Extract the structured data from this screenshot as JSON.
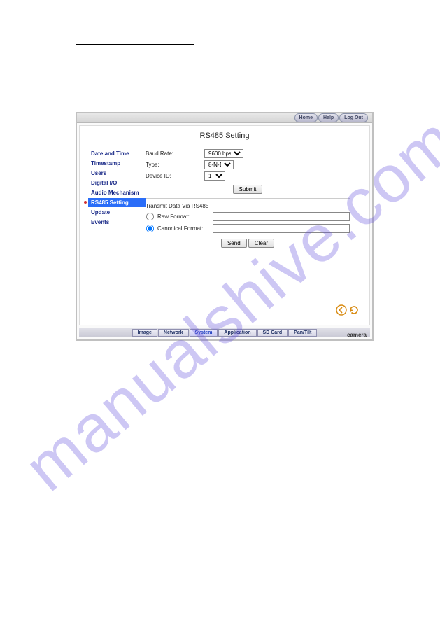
{
  "watermark": "manualshive.com",
  "topButtons": {
    "home": "Home",
    "help": "Help",
    "logout": "Log Out"
  },
  "title": "RS485 Setting",
  "sidebar": {
    "items": [
      {
        "label": "Date and Time"
      },
      {
        "label": "Timestamp"
      },
      {
        "label": "Users"
      },
      {
        "label": "Digital I/O"
      },
      {
        "label": "Audio Mechanism"
      },
      {
        "label": "RS485 Setting"
      },
      {
        "label": "Update"
      },
      {
        "label": "Events"
      }
    ],
    "activeIndex": 5
  },
  "settings": {
    "baudRate": {
      "label": "Baud Rate:",
      "value": "9600 bps"
    },
    "type": {
      "label": "Type:",
      "value": "8-N-1"
    },
    "deviceId": {
      "label": "Device ID:",
      "value": "1"
    },
    "submitLabel": "Submit"
  },
  "transmit": {
    "heading": "Transmit Data Via RS485",
    "raw": {
      "label": "Raw Format:",
      "value": "",
      "checked": false
    },
    "canonical": {
      "label": "Canonical Format:",
      "value": "",
      "checked": true
    },
    "sendLabel": "Send",
    "clearLabel": "Clear"
  },
  "bottomTabs": {
    "items": [
      {
        "label": "Image"
      },
      {
        "label": "Network"
      },
      {
        "label": "System"
      },
      {
        "label": "Application"
      },
      {
        "label": "SD Card"
      },
      {
        "label": "Pan/Tilt"
      }
    ],
    "activeIndex": 2
  },
  "footer": "camera"
}
